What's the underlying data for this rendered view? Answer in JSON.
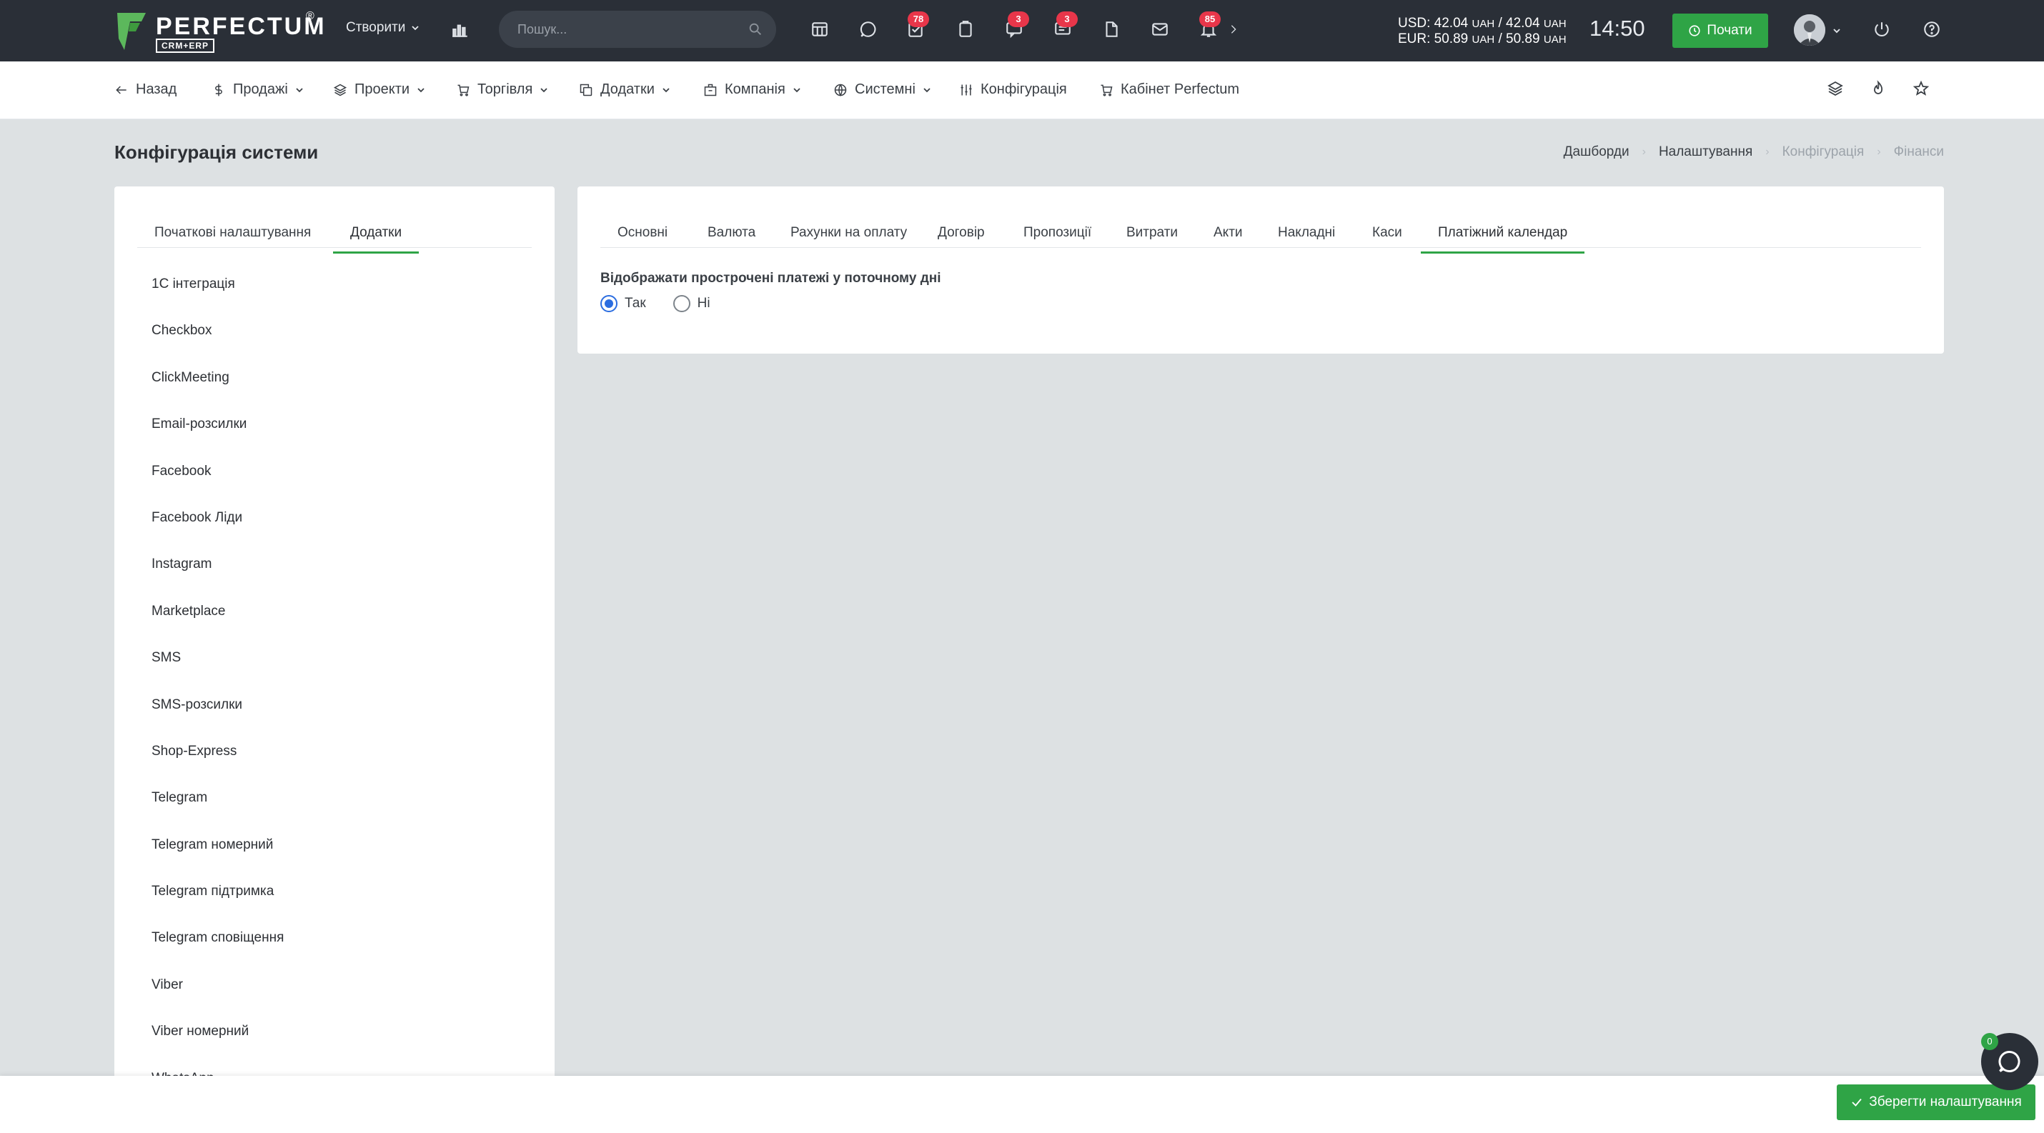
{
  "brand": {
    "name": "PERFECTUM",
    "sub": "CRM+ERP",
    "reg": "®"
  },
  "header": {
    "create_label": "Створити",
    "search": {
      "placeholder": "Пошук..."
    },
    "badges": {
      "tasks": "78",
      "chat": "3",
      "messages": "3",
      "notifications": "85"
    },
    "rates": {
      "usd": "USD: 42.04",
      "usd_buy_unit": "UAH",
      "usd_sep": " / 42.04 ",
      "usd_sell_unit": "UAH",
      "eur": "EUR: 50.89",
      "eur_buy_unit": "UAH",
      "eur_sep": " / 50.89 ",
      "eur_sell_unit": "UAH"
    },
    "time": "14:50",
    "start_label": "Почати"
  },
  "nav": {
    "back": "Назад",
    "sales": "Продажі",
    "projects": "Проекти",
    "trade": "Торгівля",
    "addons": "Додатки",
    "company": "Компанія",
    "system": "Системні",
    "config": "Конфігурація",
    "cabinet": "Кабінет Perfectum"
  },
  "page": {
    "title": "Конфігурація системи"
  },
  "breadcrumb": [
    "Дашборди",
    "Налаштування",
    "Конфігурація",
    "Фінанси"
  ],
  "left": {
    "tabs": [
      "Початкові налаштування",
      "Додатки"
    ],
    "active_tab": "Додатки",
    "items": [
      "1С інтеграція",
      "Checkbox",
      "ClickMeeting",
      "Email-розсилки",
      "Facebook",
      "Facebook Ліди",
      "Instagram",
      "Marketplace",
      "SMS",
      "SMS-розсилки",
      "Shop-Express",
      "Telegram",
      "Telegram номерний",
      "Telegram підтримка",
      "Telegram сповіщення",
      "Viber",
      "Viber номерний",
      "WhatsApp"
    ]
  },
  "right": {
    "tabs": [
      "Основні",
      "Валюта",
      "Рахунки на оплату",
      "Договір",
      "Пропозиції",
      "Витрати",
      "Акти",
      "Накладні",
      "Каси",
      "Платіжний календар"
    ],
    "active_tab": "Платіжний календар",
    "field_label": "Відображати прострочені платежі у поточному дні",
    "options": [
      "Так",
      "Ні"
    ],
    "selected": "Так"
  },
  "footer": {
    "save_label": "Зберегти налаштування",
    "chat_count": "0"
  },
  "colors": {
    "accent": "#2fa446",
    "topbar": "#2a2f37",
    "badge": "#e8364a",
    "radio": "#2b6de0"
  }
}
